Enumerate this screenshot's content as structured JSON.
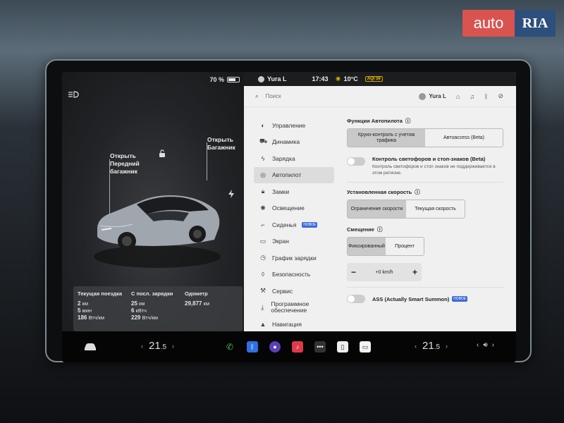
{
  "watermark": {
    "left": "auto",
    "right": "RIA"
  },
  "status_left": {
    "battery_text": "70 %",
    "battery_level": 0.7
  },
  "car_view": {
    "frunk_label": "Открыть\nПередний\nбагажник",
    "trunk_label": "Открыть\nБагажник"
  },
  "stats": {
    "trip": {
      "title": "Текущая поездка",
      "l1": "2",
      "u1": " км",
      "l2": "5",
      "u2": " мин",
      "l3": "186",
      "u3": " Втч/км"
    },
    "since_charge": {
      "title": "С посл. зарядки",
      "l1": "25",
      "u1": " км",
      "l2": "6",
      "u2": " кВтч",
      "l3": "229",
      "u3": " Втч/км"
    },
    "odometer": {
      "title": "Одометр",
      "l1": "29,877",
      "u1": " км"
    }
  },
  "top_status": {
    "user": "Yura L",
    "time": "17:43",
    "temp": "10°C",
    "badge": "AQI 59"
  },
  "search": {
    "placeholder": "Поиск",
    "user": "Yura L"
  },
  "nav": [
    {
      "label": "Управление",
      "icon": "toggle-icon"
    },
    {
      "label": "Динамика",
      "icon": "car-icon"
    },
    {
      "label": "Зарядка",
      "icon": "bolt-icon"
    },
    {
      "label": "Автопилот",
      "icon": "steering-wheel-icon",
      "active": true
    },
    {
      "label": "Замки",
      "icon": "lock-icon"
    },
    {
      "label": "Освещение",
      "icon": "sun-icon"
    },
    {
      "label": "Сиденья",
      "icon": "seat-icon",
      "badge": "НОВОЕ"
    },
    {
      "label": "Экран",
      "icon": "display-icon"
    },
    {
      "label": "График зарядки",
      "icon": "clock-icon"
    },
    {
      "label": "Безопасность",
      "icon": "shield-icon"
    },
    {
      "label": "Сервис",
      "icon": "wrench-icon"
    },
    {
      "label": "Программное обеспечение",
      "icon": "download-icon"
    },
    {
      "label": "Навигация",
      "icon": "navigation-icon"
    }
  ],
  "autopilot": {
    "features_title": "Функции Автопилота",
    "features_options": [
      "Круиз-контроль с учетом трафика",
      "Автоaccess (Beta)"
    ],
    "tl_title": "Контроль светофоров и стоп-знаков (Beta)",
    "tl_desc": "Контроль светофоров и стоп знаков не поддерживается в этом регионе.",
    "speed_title": "Установленная скорость",
    "speed_options": [
      "Ограничение скорости",
      "Текущая скорость"
    ],
    "offset_title": "Смещение",
    "offset_options": [
      "Фиксированный",
      "Процент"
    ],
    "offset_value": "+0 km/h",
    "ass_label": "ASS (Actually Smart Summon)",
    "ass_badge": "НОВОЕ"
  },
  "bottom": {
    "temp_left": "21",
    "temp_left_dec": ".5",
    "temp_right": "21",
    "temp_right_dec": ".5"
  }
}
